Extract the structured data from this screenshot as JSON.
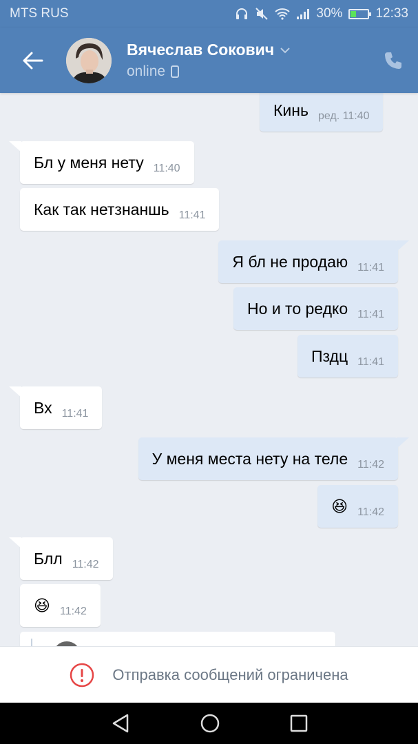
{
  "status_bar": {
    "carrier": "MTS RUS",
    "battery": "30%",
    "battery_level": 0.3,
    "time": "12:33"
  },
  "header": {
    "name": "Вячеслав Сокович",
    "presence": "online"
  },
  "messages": [
    {
      "dir": "out",
      "text": "Кинь",
      "time": "ред. 11:40"
    },
    {
      "dir": "in",
      "text": "Бл у меня нету",
      "time": "11:40"
    },
    {
      "dir": "in",
      "text": "Как так нетзнаншь",
      "time": "11:41"
    },
    {
      "dir": "out",
      "text": "Я бл не продаю",
      "time": "11:41"
    },
    {
      "dir": "out",
      "text": "Но и то редко",
      "time": "11:41"
    },
    {
      "dir": "out",
      "text": "Пздц",
      "time": "11:41"
    },
    {
      "dir": "in",
      "text": "Вх",
      "time": "11:41"
    },
    {
      "dir": "out",
      "text": "У меня места нету на теле",
      "time": "11:42"
    },
    {
      "dir": "out",
      "text": "😆",
      "time": "11:42"
    },
    {
      "dir": "in",
      "text": "Блл",
      "time": "11:42"
    },
    {
      "dir": "in",
      "text": "😆",
      "time": "11:42"
    }
  ],
  "footer": {
    "notice": "Отправка сообщений ограничена"
  },
  "colors": {
    "brand": "#5181b8",
    "out_bubble": "#dde8f6",
    "in_bubble": "#ffffff",
    "background": "#ebeef3",
    "warning": "#e64646"
  }
}
